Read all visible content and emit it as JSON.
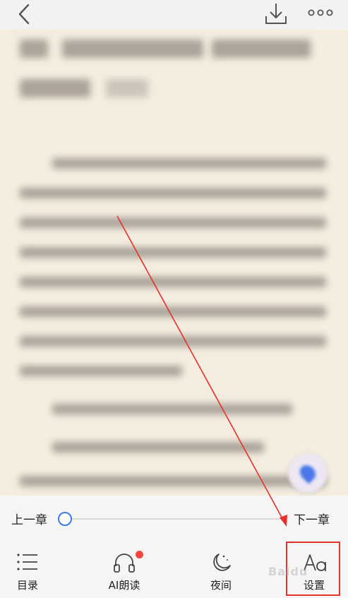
{
  "top_bar": {
    "back_icon": "chevron-left-icon",
    "download_icon": "download-icon",
    "more_icon": "more-horizontal-icon"
  },
  "reader": {
    "chapter_title": "",
    "background_color": "#f5eddf"
  },
  "chapter_nav": {
    "prev_label": "上一章",
    "next_label": "下一章",
    "progress": 0,
    "accent_color": "#3b7de8"
  },
  "toolbar": {
    "items": [
      {
        "label": "目录",
        "icon": "list-icon"
      },
      {
        "label": "AI朗读",
        "icon": "headphones-icon",
        "badge": true
      },
      {
        "label": "夜间",
        "icon": "moon-icon"
      },
      {
        "label": "设置",
        "icon": "font-settings-icon"
      }
    ]
  },
  "annotation": {
    "highlight_color": "#e8302a"
  },
  "watermark": "Baidu"
}
